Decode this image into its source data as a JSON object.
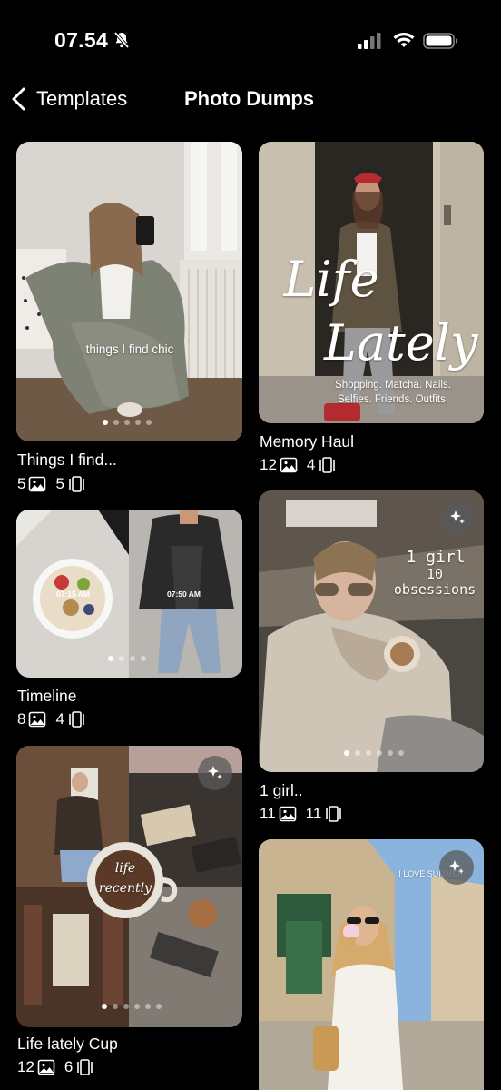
{
  "status": {
    "time": "07.54"
  },
  "nav": {
    "back_label": "Templates",
    "title": "Photo Dumps"
  },
  "cards": [
    {
      "title": "Things I find...",
      "photos": "5",
      "slides": "5",
      "overlay": "things I find chic"
    },
    {
      "title": "Memory Haul",
      "photos": "12",
      "slides": "4",
      "overlay_title_1": "Life",
      "overlay_title_2": "Lately",
      "overlay_caption_1": "Shopping. Matcha. Nails.",
      "overlay_caption_2": "Selfies. Friends. Outfits."
    },
    {
      "title": "Timeline",
      "photos": "8",
      "slides": "4",
      "time_1": "07:15 AM",
      "time_2": "07:50 AM"
    },
    {
      "title": "1 girl..",
      "photos": "11",
      "slides": "11",
      "overlay_1": "1 girl",
      "overlay_2": "10 obsessions"
    },
    {
      "title": "Life lately Cup",
      "photos": "12",
      "slides": "6",
      "overlay_1": "life",
      "overlay_2": "recently"
    },
    {
      "overlay": "I LOVE SUMMER"
    }
  ],
  "colors": {
    "background": "#000000",
    "text": "#ffffff"
  }
}
